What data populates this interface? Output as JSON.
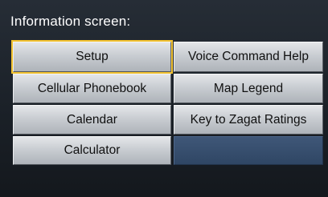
{
  "screen": {
    "title": "Information screen:"
  },
  "menu": {
    "left": [
      {
        "label": "Setup",
        "selected": true
      },
      {
        "label": "Cellular Phonebook"
      },
      {
        "label": "Calendar"
      },
      {
        "label": "Calculator"
      }
    ],
    "right": [
      {
        "label": "Voice Command Help"
      },
      {
        "label": "Map Legend"
      },
      {
        "label": "Key to Zagat Ratings"
      }
    ]
  },
  "colors": {
    "selection_outline": "#f2c230",
    "empty_slot": "#2f4664"
  }
}
